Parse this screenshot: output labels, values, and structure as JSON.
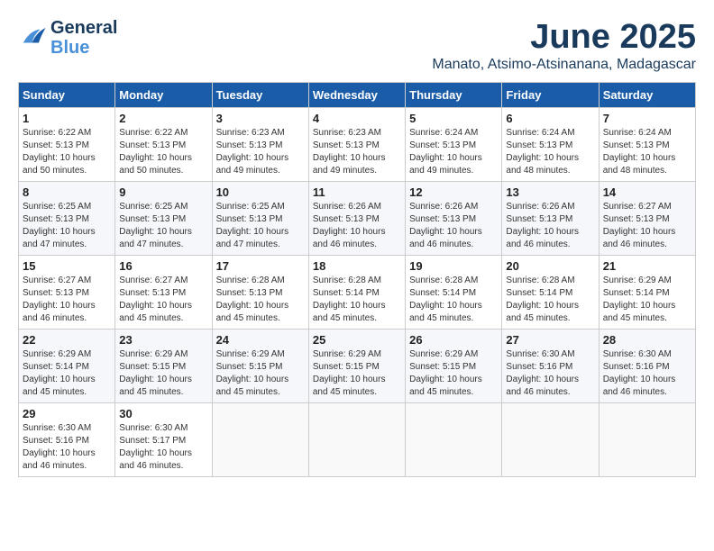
{
  "header": {
    "logo_general": "General",
    "logo_blue": "Blue",
    "month_year": "June 2025",
    "location": "Manato, Atsimo-Atsinanana, Madagascar"
  },
  "weekdays": [
    "Sunday",
    "Monday",
    "Tuesday",
    "Wednesday",
    "Thursday",
    "Friday",
    "Saturday"
  ],
  "weeks": [
    [
      {
        "day": "1",
        "sunrise": "6:22 AM",
        "sunset": "5:13 PM",
        "daylight": "10 hours and 50 minutes."
      },
      {
        "day": "2",
        "sunrise": "6:22 AM",
        "sunset": "5:13 PM",
        "daylight": "10 hours and 50 minutes."
      },
      {
        "day": "3",
        "sunrise": "6:23 AM",
        "sunset": "5:13 PM",
        "daylight": "10 hours and 49 minutes."
      },
      {
        "day": "4",
        "sunrise": "6:23 AM",
        "sunset": "5:13 PM",
        "daylight": "10 hours and 49 minutes."
      },
      {
        "day": "5",
        "sunrise": "6:24 AM",
        "sunset": "5:13 PM",
        "daylight": "10 hours and 49 minutes."
      },
      {
        "day": "6",
        "sunrise": "6:24 AM",
        "sunset": "5:13 PM",
        "daylight": "10 hours and 48 minutes."
      },
      {
        "day": "7",
        "sunrise": "6:24 AM",
        "sunset": "5:13 PM",
        "daylight": "10 hours and 48 minutes."
      }
    ],
    [
      {
        "day": "8",
        "sunrise": "6:25 AM",
        "sunset": "5:13 PM",
        "daylight": "10 hours and 47 minutes."
      },
      {
        "day": "9",
        "sunrise": "6:25 AM",
        "sunset": "5:13 PM",
        "daylight": "10 hours and 47 minutes."
      },
      {
        "day": "10",
        "sunrise": "6:25 AM",
        "sunset": "5:13 PM",
        "daylight": "10 hours and 47 minutes."
      },
      {
        "day": "11",
        "sunrise": "6:26 AM",
        "sunset": "5:13 PM",
        "daylight": "10 hours and 46 minutes."
      },
      {
        "day": "12",
        "sunrise": "6:26 AM",
        "sunset": "5:13 PM",
        "daylight": "10 hours and 46 minutes."
      },
      {
        "day": "13",
        "sunrise": "6:26 AM",
        "sunset": "5:13 PM",
        "daylight": "10 hours and 46 minutes."
      },
      {
        "day": "14",
        "sunrise": "6:27 AM",
        "sunset": "5:13 PM",
        "daylight": "10 hours and 46 minutes."
      }
    ],
    [
      {
        "day": "15",
        "sunrise": "6:27 AM",
        "sunset": "5:13 PM",
        "daylight": "10 hours and 46 minutes."
      },
      {
        "day": "16",
        "sunrise": "6:27 AM",
        "sunset": "5:13 PM",
        "daylight": "10 hours and 45 minutes."
      },
      {
        "day": "17",
        "sunrise": "6:28 AM",
        "sunset": "5:13 PM",
        "daylight": "10 hours and 45 minutes."
      },
      {
        "day": "18",
        "sunrise": "6:28 AM",
        "sunset": "5:14 PM",
        "daylight": "10 hours and 45 minutes."
      },
      {
        "day": "19",
        "sunrise": "6:28 AM",
        "sunset": "5:14 PM",
        "daylight": "10 hours and 45 minutes."
      },
      {
        "day": "20",
        "sunrise": "6:28 AM",
        "sunset": "5:14 PM",
        "daylight": "10 hours and 45 minutes."
      },
      {
        "day": "21",
        "sunrise": "6:29 AM",
        "sunset": "5:14 PM",
        "daylight": "10 hours and 45 minutes."
      }
    ],
    [
      {
        "day": "22",
        "sunrise": "6:29 AM",
        "sunset": "5:14 PM",
        "daylight": "10 hours and 45 minutes."
      },
      {
        "day": "23",
        "sunrise": "6:29 AM",
        "sunset": "5:15 PM",
        "daylight": "10 hours and 45 minutes."
      },
      {
        "day": "24",
        "sunrise": "6:29 AM",
        "sunset": "5:15 PM",
        "daylight": "10 hours and 45 minutes."
      },
      {
        "day": "25",
        "sunrise": "6:29 AM",
        "sunset": "5:15 PM",
        "daylight": "10 hours and 45 minutes."
      },
      {
        "day": "26",
        "sunrise": "6:29 AM",
        "sunset": "5:15 PM",
        "daylight": "10 hours and 45 minutes."
      },
      {
        "day": "27",
        "sunrise": "6:30 AM",
        "sunset": "5:16 PM",
        "daylight": "10 hours and 46 minutes."
      },
      {
        "day": "28",
        "sunrise": "6:30 AM",
        "sunset": "5:16 PM",
        "daylight": "10 hours and 46 minutes."
      }
    ],
    [
      {
        "day": "29",
        "sunrise": "6:30 AM",
        "sunset": "5:16 PM",
        "daylight": "10 hours and 46 minutes."
      },
      {
        "day": "30",
        "sunrise": "6:30 AM",
        "sunset": "5:17 PM",
        "daylight": "10 hours and 46 minutes."
      },
      null,
      null,
      null,
      null,
      null
    ]
  ]
}
